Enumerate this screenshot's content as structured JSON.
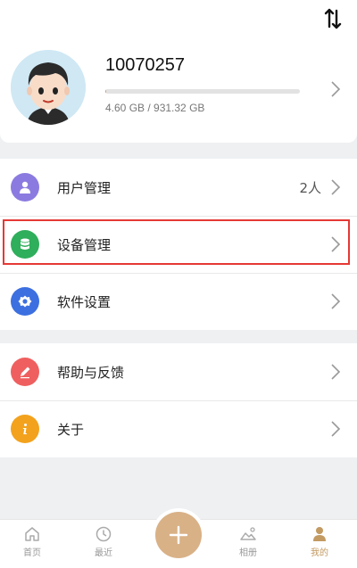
{
  "header": {
    "sort_icon": "sort-arrows-icon"
  },
  "profile": {
    "user_id": "10070257",
    "storage_text": "4.60 GB / 931.32 GB",
    "storage_used_fraction": 0.005,
    "avatar": "cartoon-boy-avatar"
  },
  "menu": {
    "group1": [
      {
        "label": "用户管理",
        "value": "2人",
        "icon": "user-icon",
        "color": "#8b7be0"
      },
      {
        "label": "设备管理",
        "value": "",
        "icon": "database-icon",
        "color": "#2fae5b"
      },
      {
        "label": "软件设置",
        "value": "",
        "icon": "gear-icon",
        "color": "#3c6fe0"
      }
    ],
    "group2": [
      {
        "label": "帮助与反馈",
        "value": "",
        "icon": "pencil-icon",
        "color": "#ef5f5f"
      },
      {
        "label": "关于",
        "value": "",
        "icon": "info-icon",
        "color": "#f3a21d"
      }
    ]
  },
  "tabbar": {
    "tabs": [
      {
        "label": "首页",
        "icon": "home-icon"
      },
      {
        "label": "最近",
        "icon": "clock-icon"
      },
      {
        "label": "相册",
        "icon": "photo-icon"
      },
      {
        "label": "我的",
        "icon": "profile-icon",
        "active": true
      }
    ],
    "add_icon": "plus-icon",
    "accent": "#c39a62"
  }
}
